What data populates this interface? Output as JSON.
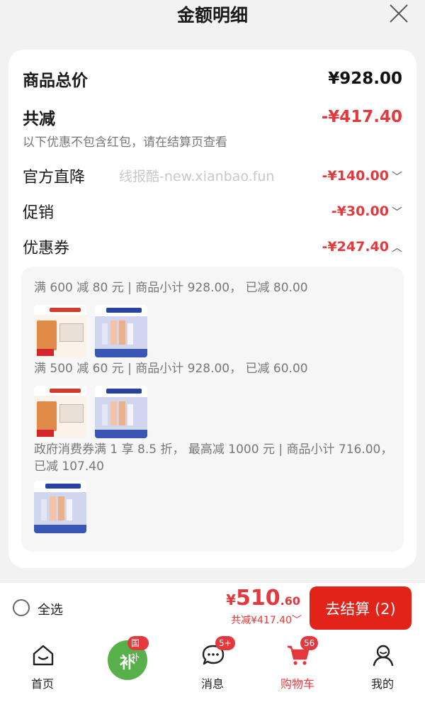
{
  "header": {
    "title": "金额明细"
  },
  "summary": {
    "total_label": "商品总价",
    "total_value": "¥928.00",
    "reduce_label": "共减",
    "reduce_value": "-¥417.40",
    "note": "以下优惠不包含红包，请在结算页查看"
  },
  "watermark": "线报酷-new.xianbao.fun",
  "discounts": [
    {
      "label": "官方直降",
      "amount": "-¥140.00",
      "chevron": "﹀"
    },
    {
      "label": "促销",
      "amount": "-¥30.00",
      "chevron": "﹀"
    },
    {
      "label": "优惠券",
      "amount": "-¥247.40",
      "chevron": "︿"
    }
  ],
  "coupons": [
    {
      "text": "满 600 减 80 元 | 商品小计 928.00，  已减 80.00"
    },
    {
      "text": "满 500 减 60 元 | 商品小计 928.00，  已减 60.00"
    },
    {
      "text": "政府消费券满 1 享 8.5 折，  最高减 1000 元 | 商品小计 716.00，已减 107.40"
    }
  ],
  "bottom": {
    "select_all": "全选",
    "price_symbol": "¥",
    "price_int": "510",
    "price_dec": ".60",
    "reduce_text": "共减¥417.40",
    "reduce_chevron": "﹀",
    "checkout": "去结算 (2)"
  },
  "tabs": [
    {
      "label": "首页",
      "icon": "home-icon"
    },
    {
      "label": "",
      "icon": "national-subsidy-icon",
      "badge": "国补",
      "text": "补"
    },
    {
      "label": "消息",
      "icon": "message-icon",
      "badge": "5+"
    },
    {
      "label": "购物车",
      "icon": "cart-icon",
      "badge": "56",
      "active": true
    },
    {
      "label": "我的",
      "icon": "profile-icon"
    }
  ],
  "colors": {
    "accent": "#e4393c",
    "checkout_bg": "#e2231a",
    "subsidy_green": "#58b04a"
  }
}
